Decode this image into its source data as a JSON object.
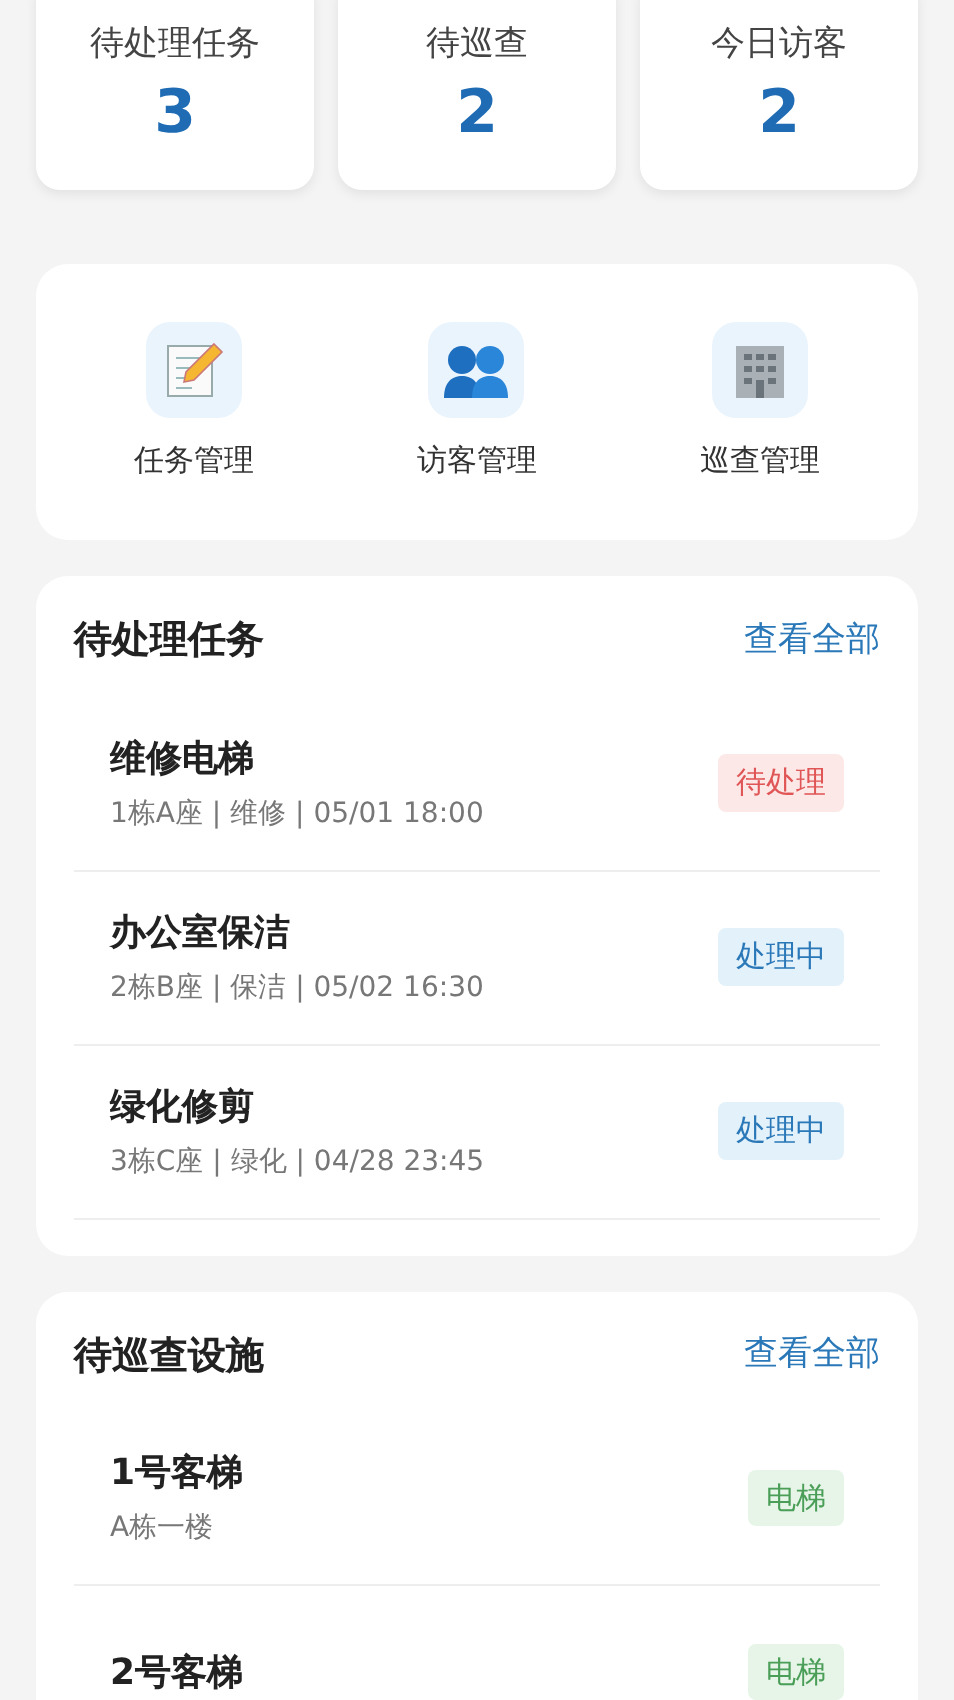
{
  "stats": [
    {
      "label": "待处理任务",
      "value": "3"
    },
    {
      "label": "待巡查",
      "value": "2"
    },
    {
      "label": "今日访客",
      "value": "2"
    }
  ],
  "shortcuts": [
    {
      "label": "任务管理",
      "kind": "memo"
    },
    {
      "label": "访客管理",
      "kind": "people"
    },
    {
      "label": "巡查管理",
      "kind": "building"
    }
  ],
  "tasks": {
    "title": "待处理任务",
    "link": "查看全部",
    "items": [
      {
        "title": "维修电梯",
        "meta": "1栋A座 | 维修 | 05/01 18:00",
        "tag": "待处理",
        "kind": "pending"
      },
      {
        "title": "办公室保洁",
        "meta": "2栋B座 | 保洁 | 05/02 16:30",
        "tag": "处理中",
        "kind": "in_progress"
      },
      {
        "title": "绿化修剪",
        "meta": "3栋C座 | 绿化 | 04/28 23:45",
        "tag": "处理中",
        "kind": "in_progress"
      }
    ]
  },
  "patrols": {
    "title": "待巡查设施",
    "link": "查看全部",
    "items": [
      {
        "title": "1号客梯",
        "meta": "A栋一楼",
        "tag": "电梯",
        "kind": "elevator"
      },
      {
        "title": "2号客梯",
        "tag": "电梯",
        "kind": "elevator"
      }
    ]
  }
}
